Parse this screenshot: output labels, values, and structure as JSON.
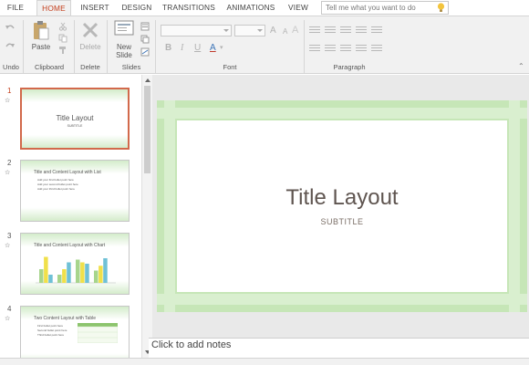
{
  "tabs": [
    "FILE",
    "HOME",
    "INSERT",
    "DESIGN",
    "TRANSITIONS",
    "ANIMATIONS",
    "VIEW"
  ],
  "active_tab": "HOME",
  "tell_me": {
    "placeholder": "Tell me what you want to do"
  },
  "ribbon": {
    "groups": {
      "undo": "Undo",
      "clipboard": "Clipboard",
      "delete": "Delete",
      "slides": "Slides",
      "font": "Font",
      "paragraph": "Paragraph"
    },
    "buttons": {
      "paste": "Paste",
      "delete": "Delete",
      "new_slide_line1": "New",
      "new_slide_line2": "Slide"
    },
    "font_glyphs": {
      "bold": "B",
      "italic": "I",
      "underline": "U",
      "strike": "abc",
      "grow": "A",
      "shrink": "A",
      "clear": "A",
      "color": "A"
    }
  },
  "slides": [
    {
      "number": "1",
      "title": "Title Layout",
      "subtitle": "SUBTITLE",
      "selected": true
    },
    {
      "number": "2",
      "title": "Title and Content Layout with List",
      "bullets": [
        "Add your first bullet point here",
        "Add your second bullet point here",
        "Add your third bullet point here"
      ]
    },
    {
      "number": "3",
      "title": "Title and Content Layout with Chart"
    },
    {
      "number": "4",
      "title": "Two Content Layout with Table",
      "bullets": [
        "First bullet point here",
        "Second bullet point here",
        "Third bullet point here"
      ]
    }
  ],
  "slide3_chart": {
    "groups": 4,
    "series_colors": [
      "#a7d58c",
      "#f0e04a",
      "#6fc1d6"
    ],
    "values": [
      [
        2.0,
        1.2,
        3.4,
        1.8
      ],
      [
        3.8,
        2.0,
        3.0,
        2.5
      ],
      [
        1.2,
        3.0,
        2.8,
        3.6
      ]
    ]
  },
  "current_slide": {
    "title": "Title Layout",
    "subtitle": "SUBTITLE"
  },
  "notes_placeholder": "Click to add notes",
  "colors": {
    "accent": "#c43e1c",
    "slide_green": "#b9dfaa",
    "selection": "#d2694b"
  }
}
